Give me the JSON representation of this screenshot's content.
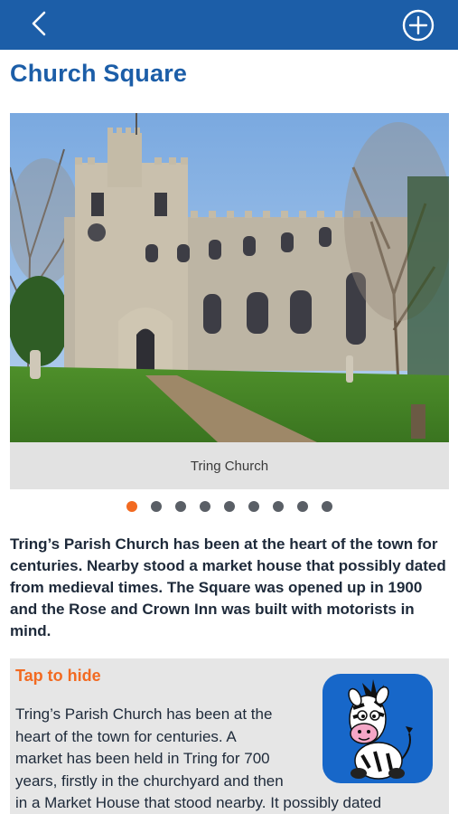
{
  "header": {
    "back_icon": "chevron-left-icon",
    "add_icon": "plus-circle-icon",
    "color": "#1c5ea8"
  },
  "page": {
    "title": "Church Square"
  },
  "gallery": {
    "caption": "Tring Church",
    "slide_count": 9,
    "active_index": 0,
    "active_color": "#f26a21",
    "inactive_color": "#5a5f66"
  },
  "summary": {
    "text": "Tring’s Parish Church has been at the heart of the town for centuries. Nearby stood a market house that possibly dated from medieval times. The Square was opened up in 1900 and the Rose and Crown Inn was built with motorists in mind."
  },
  "detail": {
    "toggle_label": "Tap to hide",
    "text_lines": [
      "Tring’s Parish Church has been at the",
      "heart of the town for centuries. A",
      "market has been held in Tring for 700",
      "years, firstly in the churchyard and then",
      "in a Market House that stood nearby. It possibly dated"
    ],
    "mascot_icon": "zebra-mascot-icon"
  }
}
